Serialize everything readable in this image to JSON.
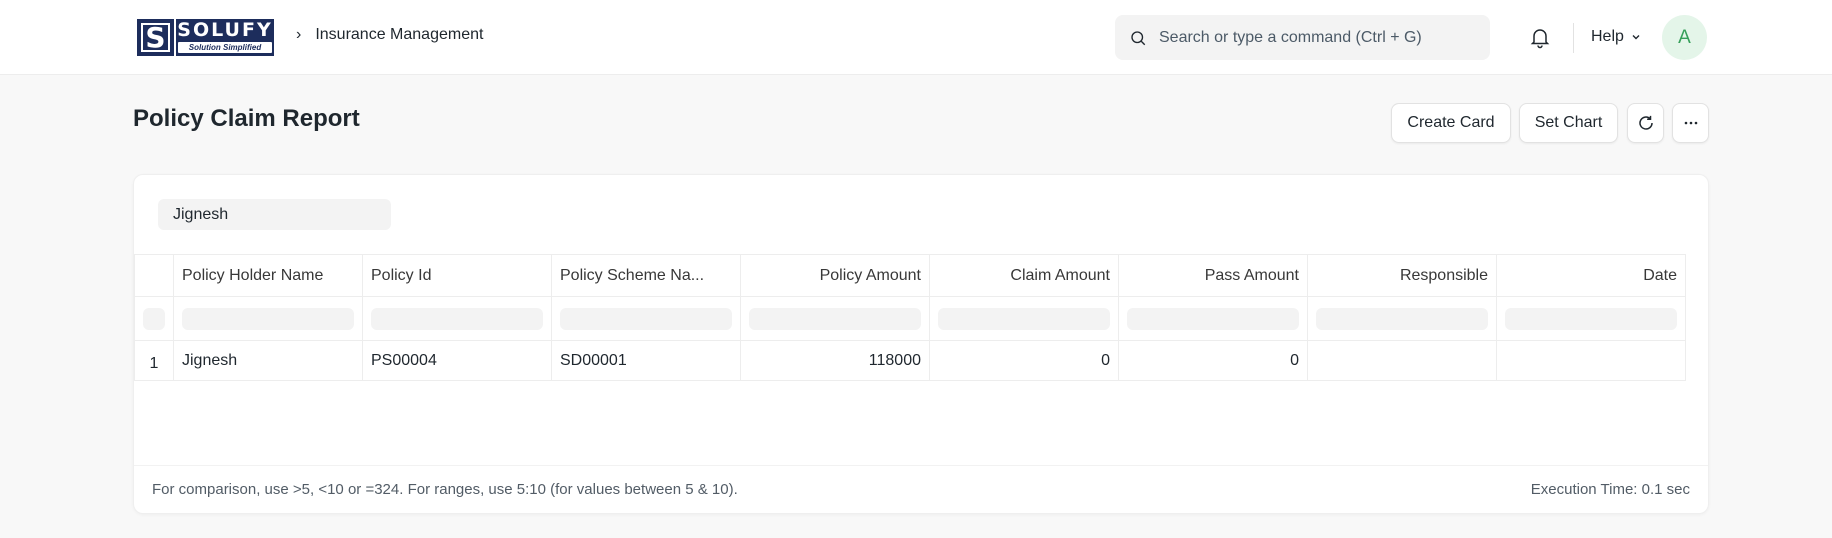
{
  "navbar": {
    "logo": {
      "mark": "S",
      "name": "SOLUFY",
      "tagline": "Solution Simplified"
    },
    "breadcrumb": [
      "Insurance Management"
    ],
    "search_placeholder": "Search or type a command (Ctrl + G)",
    "help_label": "Help",
    "avatar_initial": "A"
  },
  "page": {
    "title": "Policy Claim Report",
    "actions": {
      "create_card": "Create Card",
      "set_chart": "Set Chart"
    }
  },
  "filters": {
    "policy_holder": "Jignesh"
  },
  "table": {
    "columns": [
      "Policy Holder Name",
      "Policy Id",
      "Policy Scheme Na...",
      "Policy Amount",
      "Claim Amount",
      "Pass Amount",
      "Responsible",
      "Date"
    ],
    "rows": [
      {
        "index": "1",
        "policy_holder_name": "Jignesh",
        "policy_id": "PS00004",
        "policy_scheme": "SD00001",
        "policy_amount": "118000",
        "claim_amount": "0",
        "pass_amount": "0",
        "responsible": "",
        "date": ""
      }
    ]
  },
  "footer": {
    "hint": "For comparison, use >5, <10 or =324. For ranges, use 5:10 (for values between 5 & 10).",
    "execution_time": "Execution Time: 0.1 sec"
  }
}
